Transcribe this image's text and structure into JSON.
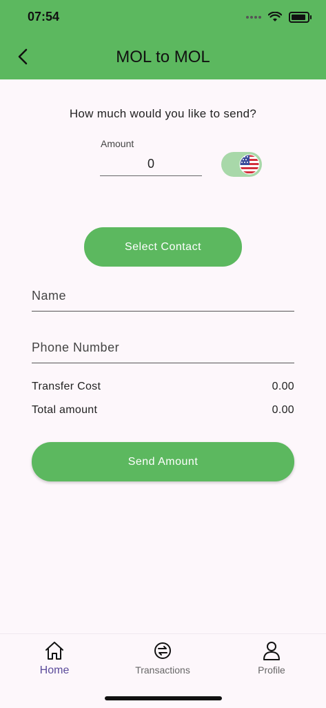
{
  "status_bar": {
    "time": "07:54"
  },
  "header": {
    "title": "MOL to MOL"
  },
  "form": {
    "question": "How much would you like to send?",
    "amount_label": "Amount",
    "amount_value": "0",
    "select_contact_label": "Select Contact",
    "name_placeholder": "Name",
    "phone_placeholder": "Phone Number",
    "transfer_cost_label": "Transfer Cost",
    "transfer_cost_value": "0.00",
    "total_amount_label": "Total amount",
    "total_amount_value": "0.00",
    "send_button_label": "Send Amount"
  },
  "nav": {
    "items": [
      {
        "label": "Home",
        "icon": "home-icon",
        "active": true
      },
      {
        "label": "Transactions",
        "icon": "transfer-icon",
        "active": false
      },
      {
        "label": "Profile",
        "icon": "profile-icon",
        "active": false
      }
    ]
  },
  "colors": {
    "accent": "#5cb85f",
    "toggle_bg": "#a8d8a9",
    "active_nav": "#5a4a9a",
    "background": "#fdf7fb"
  }
}
